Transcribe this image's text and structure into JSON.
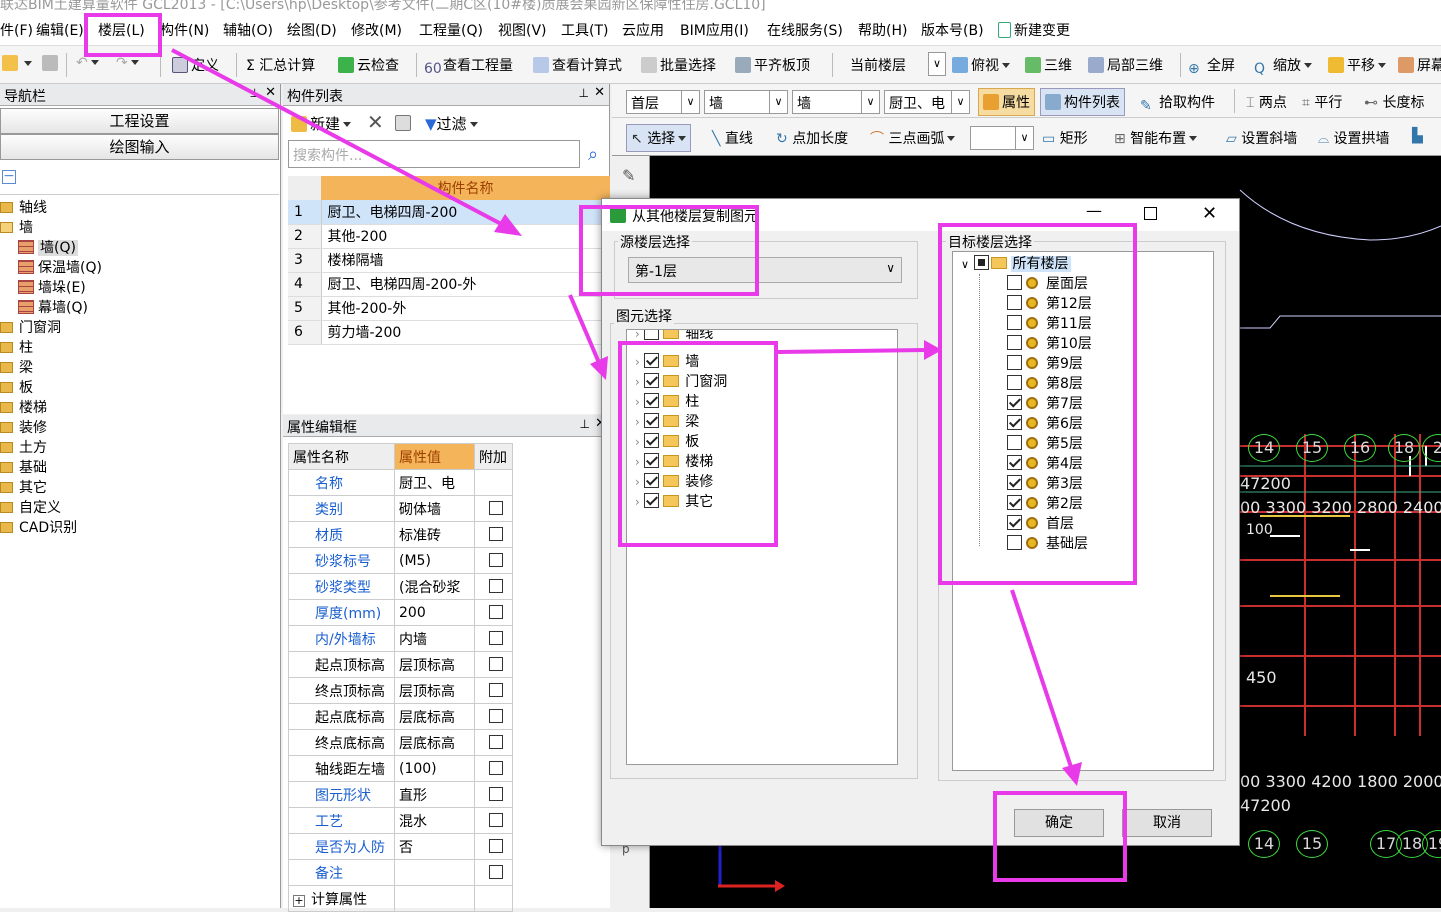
{
  "window_title": "联达BIM土建算量软件 GCL2013 - [C:\\Users\\hp\\Desktop\\参考文件(二期C区(10#楼)质展会果园新区保障性住房.GCL10]",
  "menu": [
    "件(F)",
    "编辑(E)",
    "楼层(L)",
    "构件(N)",
    "辅轴(O)",
    "绘图(D)",
    "修改(M)",
    "工程量(Q)",
    "视图(V)",
    "工具(T)",
    "云应用",
    "BIM应用(I)",
    "在线服务(S)",
    "帮助(H)",
    "版本号(B)",
    "新建变更"
  ],
  "toolbar1": [
    "定义",
    "Σ 汇总计算",
    "云检查",
    "查看工程量",
    "查看计算式",
    "批量选择",
    "平齐板顶",
    "当前楼层",
    "俯视",
    "三维",
    "局部三维",
    "全屏",
    "缩放",
    "平移",
    "屏幕"
  ],
  "nav": {
    "title": "导航栏",
    "btn1": "工程设置",
    "btn2": "绘图输入",
    "tree": [
      "轴线",
      "墙",
      "墙(Q)",
      "保温墙(Q)",
      "墙垛(E)",
      "幕墙(Q)",
      "门窗洞",
      "柱",
      "梁",
      "板",
      "楼梯",
      "装修",
      "土方",
      "基础",
      "其它",
      "自定义",
      "CAD识别"
    ]
  },
  "complist": {
    "title": "构件列表",
    "new_label": "新建",
    "filter_label": "过滤",
    "search_placeholder": "搜索构件...",
    "header": "构件名称",
    "rows": [
      "厨卫、电梯四周-200",
      "其他-200",
      "楼梯隔墙",
      "厨卫、电梯四周-200-外",
      "其他-200-外",
      "剪力墙-200"
    ]
  },
  "props": {
    "title": "属性编辑框",
    "headers": [
      "属性名称",
      "属性值",
      "附加"
    ],
    "rows": [
      [
        "名称",
        "厨卫、电"
      ],
      [
        "类别",
        "砌体墙"
      ],
      [
        "材质",
        "标准砖"
      ],
      [
        "砂浆标号",
        "(M5)"
      ],
      [
        "砂浆类型",
        "(混合砂浆"
      ],
      [
        "厚度(mm)",
        "200"
      ],
      [
        "内/外墙标",
        "内墙"
      ],
      [
        "起点顶标高",
        "层顶标高"
      ],
      [
        "终点顶标高",
        "层顶标高"
      ],
      [
        "起点底标高",
        "层底标高"
      ],
      [
        "终点底标高",
        "层底标高"
      ],
      [
        "轴线距左墙",
        "(100)"
      ],
      [
        "图元形状",
        "直形"
      ],
      [
        "工艺",
        "混水"
      ],
      [
        "是否为人防",
        "否"
      ],
      [
        "备注",
        ""
      ]
    ],
    "footer": "计算属性"
  },
  "rtoolbar1": {
    "floor": "首层",
    "type1": "墙",
    "type2": "墙",
    "comp": "厨卫、电",
    "items": [
      "属性",
      "构件列表",
      "拾取构件",
      "两点",
      "平行",
      "长度标"
    ]
  },
  "rtoolbar2": [
    "选择",
    "直线",
    "点加长度",
    "三点画弧",
    "矩形",
    "智能布置",
    "设置斜墙",
    "设置拱墙"
  ],
  "cad": {
    "top_nums": [
      "14",
      "15",
      "16",
      "18",
      "2"
    ],
    "bottom_nums": [
      "14",
      "15",
      "17",
      "18",
      "19"
    ],
    "dims_top": "47200",
    "dims_row": "00 3300 3200 2800 2400",
    "dims_row2": "00 3300 4200 1800 2000",
    "dims_bottom": "47200",
    "small1": "100",
    "small2": "450"
  },
  "dialog": {
    "title": "从其他楼层复制图元",
    "source_label": "源楼层选择",
    "source_value": "第-1层",
    "elem_label": "图元选择",
    "elements": [
      {
        "name": "轴线",
        "checked": false
      },
      {
        "name": "墙",
        "checked": true
      },
      {
        "name": "门窗洞",
        "checked": true
      },
      {
        "name": "柱",
        "checked": true
      },
      {
        "name": "梁",
        "checked": true
      },
      {
        "name": "板",
        "checked": true
      },
      {
        "name": "楼梯",
        "checked": true
      },
      {
        "name": "装修",
        "checked": true
      },
      {
        "name": "其它",
        "checked": true
      }
    ],
    "target_label": "目标楼层选择",
    "all_floors": "所有楼层",
    "floors": [
      {
        "name": "屋面层",
        "checked": false
      },
      {
        "name": "第12层",
        "checked": false
      },
      {
        "name": "第11层",
        "checked": false
      },
      {
        "name": "第10层",
        "checked": false
      },
      {
        "name": "第9层",
        "checked": false
      },
      {
        "name": "第8层",
        "checked": false
      },
      {
        "name": "第7层",
        "checked": true
      },
      {
        "name": "第6层",
        "checked": true
      },
      {
        "name": "第5层",
        "checked": false
      },
      {
        "name": "第4层",
        "checked": true
      },
      {
        "name": "第3层",
        "checked": true
      },
      {
        "name": "第2层",
        "checked": true
      },
      {
        "name": "首层",
        "checked": true
      },
      {
        "name": "基础层",
        "checked": false
      }
    ],
    "ok": "确定",
    "cancel": "取消"
  },
  "highlight_color": "#e83ae8"
}
